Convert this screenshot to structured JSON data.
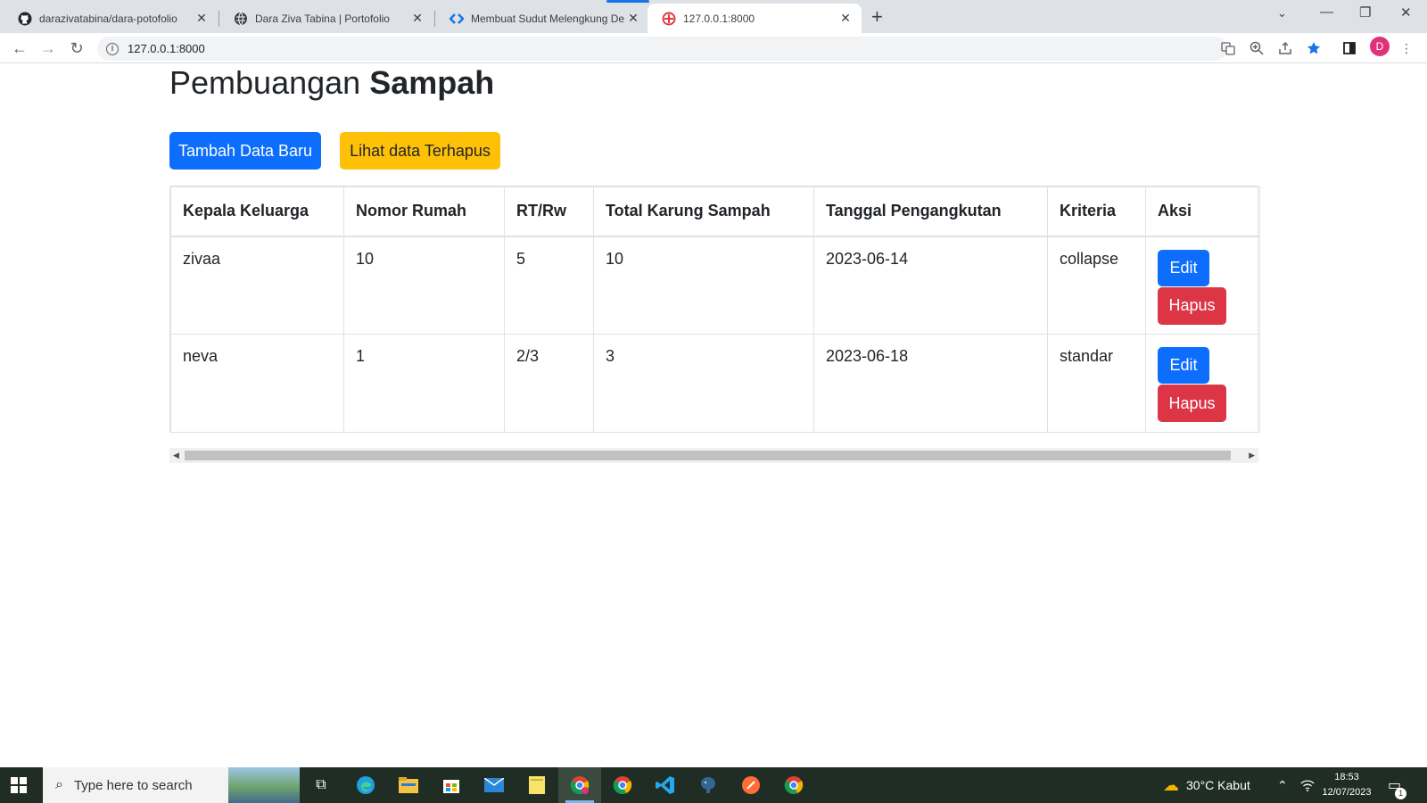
{
  "browser": {
    "tabs": [
      {
        "title": "darazivatabina/dara-potofolio",
        "icon": "github-icon"
      },
      {
        "title": "Dara Ziva Tabina | Portofolio",
        "icon": "globe-icon"
      },
      {
        "title": "Membuat Sudut Melengkung De",
        "icon": "code-icon"
      },
      {
        "title": "127.0.0.1:8000",
        "icon": "laravel-icon"
      }
    ],
    "url": "127.0.0.1:8000",
    "profile_initial": "D"
  },
  "page": {
    "title_normal": "Pembuangan ",
    "title_bold": "Sampah",
    "add_button": "Tambah Data Baru",
    "deleted_button": "Lihat data Terhapus",
    "columns": [
      "Kepala Keluarga",
      "Nomor Rumah",
      "RT/Rw",
      "Total Karung Sampah",
      "Tanggal Pengangkutan",
      "Kriteria",
      "Aksi"
    ],
    "rows": [
      {
        "kepala": "zivaa",
        "nomor": "10",
        "rtrw": "5",
        "total": "10",
        "tanggal": "2023-06-14",
        "kriteria": "collapse"
      },
      {
        "kepala": "neva",
        "nomor": "1",
        "rtrw": "2/3",
        "total": "3",
        "tanggal": "2023-06-18",
        "kriteria": "standar"
      }
    ],
    "edit_label": "Edit",
    "delete_label": "Hapus"
  },
  "taskbar": {
    "search_placeholder": "Type here to search",
    "weather": "30°C  Kabut",
    "time": "18:53",
    "date": "12/07/2023",
    "notifications": "1"
  },
  "colors": {
    "primary": "#0d6efd",
    "warning": "#ffc107",
    "danger": "#dc3545"
  }
}
